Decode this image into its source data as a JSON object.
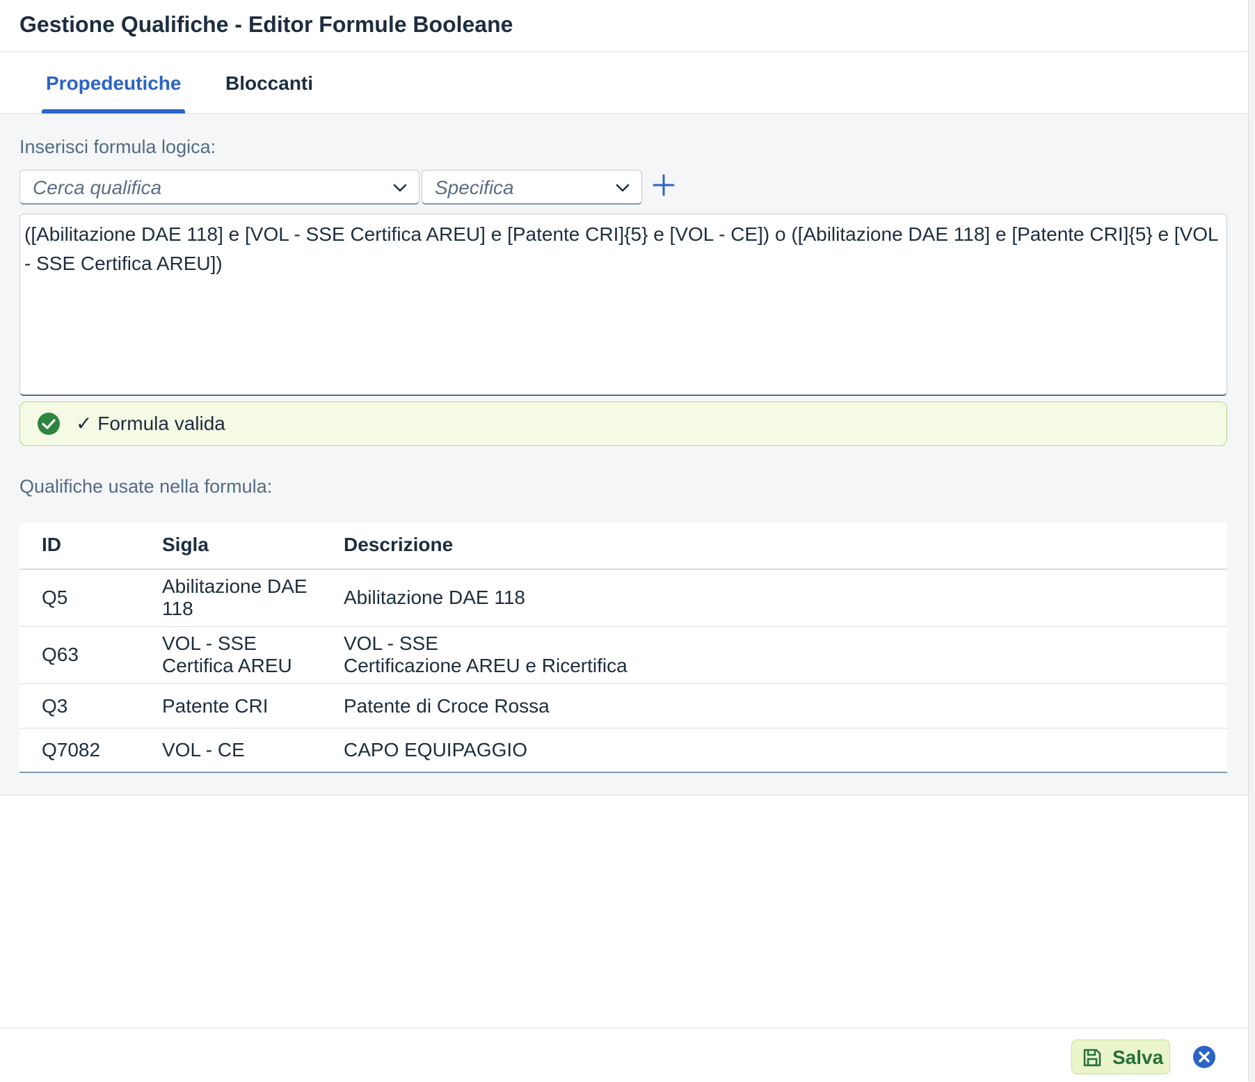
{
  "dialog": {
    "title": "Gestione Qualifiche - Editor Formule Booleane"
  },
  "tabs": [
    {
      "label": "Propedeutiche",
      "active": true
    },
    {
      "label": "Bloccanti",
      "active": false
    }
  ],
  "formula_section": {
    "label": "Inserisci formula logica:",
    "qualifica_placeholder": "Cerca qualifica",
    "specifica_placeholder": "Specifica",
    "formula_text": "([Abilitazione DAE 118] e [VOL - SSE Certifica AREU] e [Patente CRI]{5} e [VOL - CE]) o ([Abilitazione DAE 118] e [Patente CRI]{5} e [VOL - SSE Certifica AREU])",
    "validation_message": "✓ Formula valida"
  },
  "qualifiche": {
    "label": "Qualifiche usate nella formula:",
    "columns": [
      "ID",
      "Sigla",
      "Descrizione"
    ],
    "rows": [
      {
        "id": "Q5",
        "sigla": "Abilitazione DAE\n118",
        "descrizione": "Abilitazione DAE 118"
      },
      {
        "id": "Q63",
        "sigla": "VOL - SSE\nCertifica AREU",
        "descrizione": "VOL - SSE\nCertificazione AREU e Ricertifica"
      },
      {
        "id": "Q3",
        "sigla": "Patente CRI",
        "descrizione": "Patente di Croce Rossa"
      },
      {
        "id": "Q7082",
        "sigla": "VOL - CE",
        "descrizione": "CAPO EQUIPAGGIO"
      }
    ]
  },
  "footer": {
    "save_label": "Salva"
  },
  "colors": {
    "accent": "#2b63c7",
    "success": "#2e8540",
    "success_bg": "#f5fae5"
  }
}
